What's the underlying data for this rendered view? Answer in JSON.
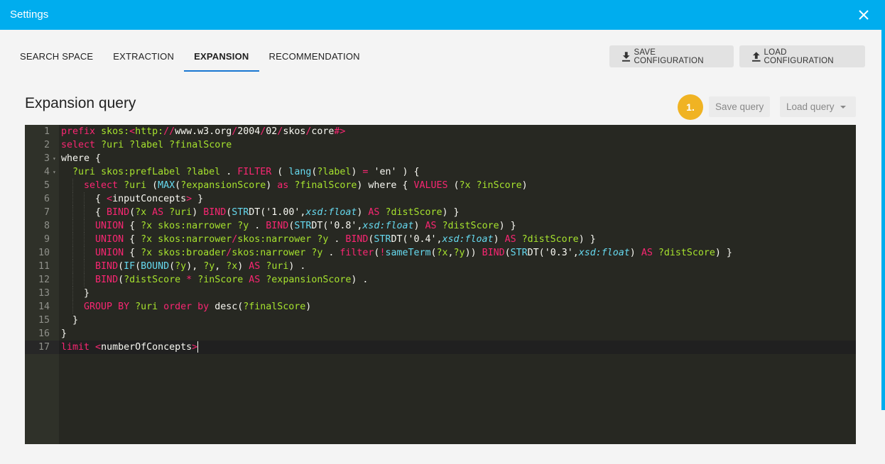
{
  "window": {
    "title": "Settings",
    "close_icon": "close-icon",
    "accent_color": "#00adee"
  },
  "tabs": [
    {
      "label": "SEARCH SPACE",
      "active": false
    },
    {
      "label": "EXTRACTION",
      "active": false
    },
    {
      "label": "EXPANSION",
      "active": true
    },
    {
      "label": "RECOMMENDATION",
      "active": false
    }
  ],
  "toolbar": {
    "save_config_label": "SAVE CONFIGURATION",
    "save_config_icon": "download-icon",
    "load_config_label": "LOAD CONFIGURATION",
    "load_config_icon": "upload-icon"
  },
  "section": {
    "title": "Expansion query",
    "step_badge": "1.",
    "save_query_label": "Save query",
    "load_query_label": "Load query"
  },
  "editor": {
    "active_line": 17,
    "lines": [
      {
        "n": "1",
        "fold": false,
        "indent": 0,
        "tokens": [
          [
            "kw",
            "prefix"
          ],
          [
            "pl",
            " "
          ],
          [
            "var",
            "skos:"
          ],
          [
            "kw",
            "<"
          ],
          [
            "var",
            "http:"
          ],
          [
            "kw",
            "//"
          ],
          [
            "pl",
            "www.w3.org"
          ],
          [
            "kw",
            "/"
          ],
          [
            "pl",
            "2004"
          ],
          [
            "kw",
            "/"
          ],
          [
            "pl",
            "02"
          ],
          [
            "kw",
            "/"
          ],
          [
            "pl",
            "skos"
          ],
          [
            "kw",
            "/"
          ],
          [
            "pl",
            "core"
          ],
          [
            "kw",
            "#>"
          ]
        ]
      },
      {
        "n": "2",
        "fold": false,
        "indent": 0,
        "tokens": [
          [
            "kw",
            "select"
          ],
          [
            "pl",
            " "
          ],
          [
            "var",
            "?uri"
          ],
          [
            "pl",
            " "
          ],
          [
            "var",
            "?label"
          ],
          [
            "pl",
            " "
          ],
          [
            "var",
            "?finalScore"
          ]
        ]
      },
      {
        "n": "3",
        "fold": true,
        "indent": 0,
        "tokens": [
          [
            "pl",
            "where {"
          ]
        ]
      },
      {
        "n": "4",
        "fold": true,
        "indent": 1,
        "tokens": [
          [
            "pl",
            "  "
          ],
          [
            "var",
            "?uri"
          ],
          [
            "pl",
            " "
          ],
          [
            "var",
            "skos:prefLabel"
          ],
          [
            "pl",
            " "
          ],
          [
            "var",
            "?label"
          ],
          [
            "pl",
            " . "
          ],
          [
            "kw",
            "FILTER"
          ],
          [
            "pl",
            " ( "
          ],
          [
            "fn",
            "lang"
          ],
          [
            "pl",
            "("
          ],
          [
            "var",
            "?label"
          ],
          [
            "pl",
            ") "
          ],
          [
            "kw",
            "="
          ],
          [
            "pl",
            " 'en' ) {"
          ]
        ]
      },
      {
        "n": "5",
        "fold": false,
        "indent": 2,
        "tokens": [
          [
            "pl",
            "    "
          ],
          [
            "kw",
            "select"
          ],
          [
            "pl",
            " "
          ],
          [
            "var",
            "?uri"
          ],
          [
            "pl",
            " ("
          ],
          [
            "fn",
            "MAX"
          ],
          [
            "pl",
            "("
          ],
          [
            "var",
            "?expansionScore"
          ],
          [
            "pl",
            ") "
          ],
          [
            "kw",
            "as"
          ],
          [
            "pl",
            " "
          ],
          [
            "var",
            "?finalScore"
          ],
          [
            "pl",
            ") where { "
          ],
          [
            "kw",
            "VALUES"
          ],
          [
            "pl",
            " ("
          ],
          [
            "var",
            "?x"
          ],
          [
            "pl",
            " "
          ],
          [
            "var",
            "?inScore"
          ],
          [
            "pl",
            ")"
          ]
        ]
      },
      {
        "n": "6",
        "fold": false,
        "indent": 3,
        "tokens": [
          [
            "pl",
            "      { "
          ],
          [
            "kw",
            "<"
          ],
          [
            "pl",
            "inputConcepts"
          ],
          [
            "kw",
            ">"
          ],
          [
            "pl",
            " }"
          ]
        ]
      },
      {
        "n": "7",
        "fold": false,
        "indent": 3,
        "tokens": [
          [
            "pl",
            "      { "
          ],
          [
            "kw",
            "BIND"
          ],
          [
            "pl",
            "("
          ],
          [
            "var",
            "?x"
          ],
          [
            "pl",
            " "
          ],
          [
            "kw",
            "AS"
          ],
          [
            "pl",
            " "
          ],
          [
            "var",
            "?uri"
          ],
          [
            "pl",
            ") "
          ],
          [
            "kw",
            "BIND"
          ],
          [
            "pl",
            "("
          ],
          [
            "fn",
            "STR"
          ],
          [
            "pl",
            "DT('1.00',"
          ],
          [
            "ty",
            "xsd:float"
          ],
          [
            "pl",
            ") "
          ],
          [
            "kw",
            "AS"
          ],
          [
            "pl",
            " "
          ],
          [
            "var",
            "?distScore"
          ],
          [
            "pl",
            ") }"
          ]
        ]
      },
      {
        "n": "8",
        "fold": false,
        "indent": 3,
        "tokens": [
          [
            "pl",
            "      "
          ],
          [
            "kw",
            "UNION"
          ],
          [
            "pl",
            " { "
          ],
          [
            "var",
            "?x"
          ],
          [
            "pl",
            " "
          ],
          [
            "var",
            "skos:narrower"
          ],
          [
            "pl",
            " "
          ],
          [
            "var",
            "?y"
          ],
          [
            "pl",
            " . "
          ],
          [
            "kw",
            "BIND"
          ],
          [
            "pl",
            "("
          ],
          [
            "fn",
            "STR"
          ],
          [
            "pl",
            "DT('0.8',"
          ],
          [
            "ty",
            "xsd:float"
          ],
          [
            "pl",
            ") "
          ],
          [
            "kw",
            "AS"
          ],
          [
            "pl",
            " "
          ],
          [
            "var",
            "?distScore"
          ],
          [
            "pl",
            ") }"
          ]
        ]
      },
      {
        "n": "9",
        "fold": false,
        "indent": 3,
        "tokens": [
          [
            "pl",
            "      "
          ],
          [
            "kw",
            "UNION"
          ],
          [
            "pl",
            " { "
          ],
          [
            "var",
            "?x"
          ],
          [
            "pl",
            " "
          ],
          [
            "var",
            "skos:narrower"
          ],
          [
            "kw",
            "/"
          ],
          [
            "var",
            "skos:narrower"
          ],
          [
            "pl",
            " "
          ],
          [
            "var",
            "?y"
          ],
          [
            "pl",
            " . "
          ],
          [
            "kw",
            "BIND"
          ],
          [
            "pl",
            "("
          ],
          [
            "fn",
            "STR"
          ],
          [
            "pl",
            "DT('0.4',"
          ],
          [
            "ty",
            "xsd:float"
          ],
          [
            "pl",
            ") "
          ],
          [
            "kw",
            "AS"
          ],
          [
            "pl",
            " "
          ],
          [
            "var",
            "?distScore"
          ],
          [
            "pl",
            ") }"
          ]
        ]
      },
      {
        "n": "10",
        "fold": false,
        "indent": 3,
        "tokens": [
          [
            "pl",
            "      "
          ],
          [
            "kw",
            "UNION"
          ],
          [
            "pl",
            " { "
          ],
          [
            "var",
            "?x"
          ],
          [
            "pl",
            " "
          ],
          [
            "var",
            "skos:broader"
          ],
          [
            "kw",
            "/"
          ],
          [
            "var",
            "skos:narrower"
          ],
          [
            "pl",
            " "
          ],
          [
            "var",
            "?y"
          ],
          [
            "pl",
            " . "
          ],
          [
            "kw",
            "filter"
          ],
          [
            "pl",
            "("
          ],
          [
            "kw",
            "!"
          ],
          [
            "fn",
            "sameTerm"
          ],
          [
            "pl",
            "("
          ],
          [
            "var",
            "?x"
          ],
          [
            "pl",
            ","
          ],
          [
            "var",
            "?y"
          ],
          [
            "pl",
            ")) "
          ],
          [
            "kw",
            "BIND"
          ],
          [
            "pl",
            "("
          ],
          [
            "fn",
            "STR"
          ],
          [
            "pl",
            "DT('0.3',"
          ],
          [
            "ty",
            "xsd:float"
          ],
          [
            "pl",
            ") "
          ],
          [
            "kw",
            "AS"
          ],
          [
            "pl",
            " "
          ],
          [
            "var",
            "?distScore"
          ],
          [
            "pl",
            ") }"
          ]
        ]
      },
      {
        "n": "11",
        "fold": false,
        "indent": 3,
        "tokens": [
          [
            "pl",
            "      "
          ],
          [
            "kw",
            "BIND"
          ],
          [
            "pl",
            "("
          ],
          [
            "fn",
            "IF"
          ],
          [
            "pl",
            "("
          ],
          [
            "fn",
            "BOUND"
          ],
          [
            "pl",
            "("
          ],
          [
            "var",
            "?y"
          ],
          [
            "pl",
            "), "
          ],
          [
            "var",
            "?y"
          ],
          [
            "pl",
            ", "
          ],
          [
            "var",
            "?x"
          ],
          [
            "pl",
            ") "
          ],
          [
            "kw",
            "AS"
          ],
          [
            "pl",
            " "
          ],
          [
            "var",
            "?uri"
          ],
          [
            "pl",
            ") ."
          ]
        ]
      },
      {
        "n": "12",
        "fold": false,
        "indent": 3,
        "tokens": [
          [
            "pl",
            "      "
          ],
          [
            "kw",
            "BIND"
          ],
          [
            "pl",
            "("
          ],
          [
            "var",
            "?distScore"
          ],
          [
            "pl",
            " "
          ],
          [
            "kw",
            "*"
          ],
          [
            "pl",
            " "
          ],
          [
            "var",
            "?inScore"
          ],
          [
            "pl",
            " "
          ],
          [
            "kw",
            "AS"
          ],
          [
            "pl",
            " "
          ],
          [
            "var",
            "?expansionScore"
          ],
          [
            "pl",
            ") ."
          ]
        ]
      },
      {
        "n": "13",
        "fold": false,
        "indent": 2,
        "tokens": [
          [
            "pl",
            "    }"
          ]
        ]
      },
      {
        "n": "14",
        "fold": false,
        "indent": 2,
        "tokens": [
          [
            "pl",
            "    "
          ],
          [
            "kw",
            "GROUP BY"
          ],
          [
            "pl",
            " "
          ],
          [
            "var",
            "?uri"
          ],
          [
            "pl",
            " "
          ],
          [
            "kw",
            "order by"
          ],
          [
            "pl",
            " desc("
          ],
          [
            "var",
            "?finalScore"
          ],
          [
            "pl",
            ")"
          ]
        ]
      },
      {
        "n": "15",
        "fold": false,
        "indent": 1,
        "tokens": [
          [
            "pl",
            "  }"
          ]
        ]
      },
      {
        "n": "16",
        "fold": false,
        "indent": 0,
        "tokens": [
          [
            "pl",
            "}"
          ]
        ]
      },
      {
        "n": "17",
        "fold": false,
        "indent": 0,
        "tokens": [
          [
            "kw",
            "limit"
          ],
          [
            "pl",
            " "
          ],
          [
            "kw",
            "<"
          ],
          [
            "pl",
            "numberOfConcepts"
          ],
          [
            "kw",
            ">"
          ]
        ]
      }
    ]
  }
}
